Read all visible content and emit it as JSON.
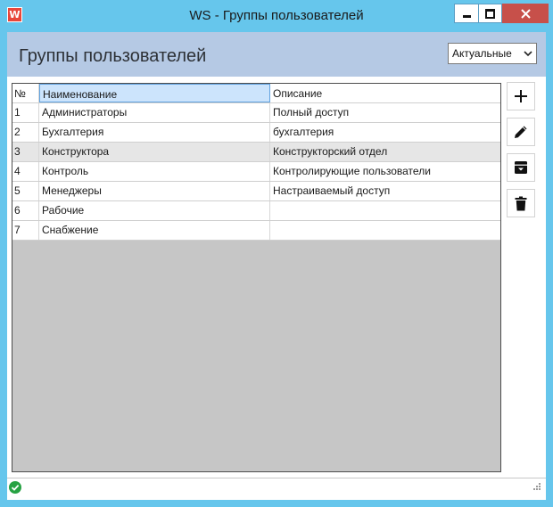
{
  "window": {
    "app_icon_letter": "W",
    "title": "WS - Группы пользователей"
  },
  "header": {
    "title": "Группы пользователей",
    "filter_selected": "Актуальные"
  },
  "table": {
    "columns": [
      "№",
      "Наименование",
      "Описание"
    ],
    "rows": [
      {
        "num": "1",
        "name": "Администраторы",
        "desc": "Полный доступ"
      },
      {
        "num": "2",
        "name": "Бухгалтерия",
        "desc": "бухгалтерия"
      },
      {
        "num": "3",
        "name": "Конструктора",
        "desc": "Конструкторский отдел"
      },
      {
        "num": "4",
        "name": "Контроль",
        "desc": "Контролирующие пользователи"
      },
      {
        "num": "5",
        "name": "Менеджеры",
        "desc": "Настраиваемый доступ"
      },
      {
        "num": "6",
        "name": "Рабочие",
        "desc": ""
      },
      {
        "num": "7",
        "name": "Снабжение",
        "desc": ""
      }
    ],
    "selected_row_index": 2
  },
  "side_buttons": [
    {
      "icon": "plus-icon"
    },
    {
      "icon": "pencil-icon"
    },
    {
      "icon": "archive-icon"
    },
    {
      "icon": "trash-icon"
    }
  ],
  "colors": {
    "window_frame": "#66c6ec",
    "header_bg": "#b5c9e4",
    "close_button": "#c7504a",
    "grid_empty_bg": "#c6c6c6",
    "selected_row": "#e6e6e6",
    "status_ok": "#27a243"
  }
}
